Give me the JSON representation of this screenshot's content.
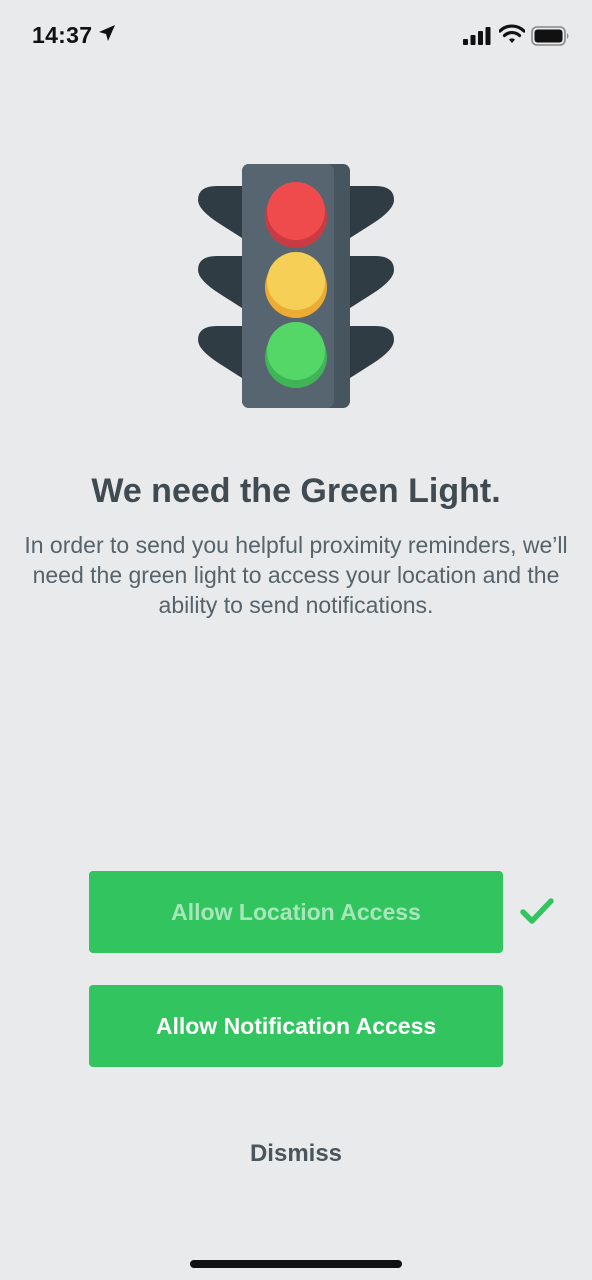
{
  "status_bar": {
    "time": "14:37",
    "icons": [
      "location-arrow-icon",
      "cellular-signal-icon",
      "wifi-icon",
      "battery-icon"
    ]
  },
  "illustration": {
    "icon": "traffic-light-icon",
    "colors": {
      "red": "#f04b4c",
      "yellow": "#f6cf56",
      "green": "#55d768",
      "body": "#56656f"
    }
  },
  "headline": "We need the Green Light.",
  "description": "In order to send you helpful proximity reminders, we’ll need the green light to access your location and the ability to send notifications.",
  "buttons": {
    "location": {
      "label": "Allow Location Access",
      "granted": true
    },
    "notification": {
      "label": "Allow Notification Access"
    }
  },
  "check_icon": "checkmark-icon",
  "dismiss_label": "Dismiss",
  "colors": {
    "background": "#e9eaec",
    "button": "#32c55f",
    "check": "#32c55f"
  }
}
